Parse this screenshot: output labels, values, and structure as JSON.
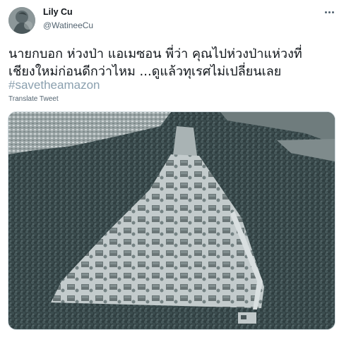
{
  "author": {
    "display_name": "Lily Cu",
    "handle": "@WatineeCu"
  },
  "tweet": {
    "text_line_1": "นายกบอก ห่วงป่า แอเมซอน  พี่ว่า คุณไปห่วงป่าแห่วงที่",
    "text_line_2": "เชียงใหม่ก่อนดีกว่าไหม ...ดูแล้วทุเรศไม่เปลี่ยนเลย",
    "hashtag": "#savetheamazon",
    "translate_label": "Translate Tweet"
  },
  "icons": {
    "more": "more-options-icon",
    "avatar": "user-avatar"
  },
  "colors": {
    "hashtag": "#8ba0af",
    "secondary_text": "#536471",
    "primary_text": "#0f1419"
  }
}
